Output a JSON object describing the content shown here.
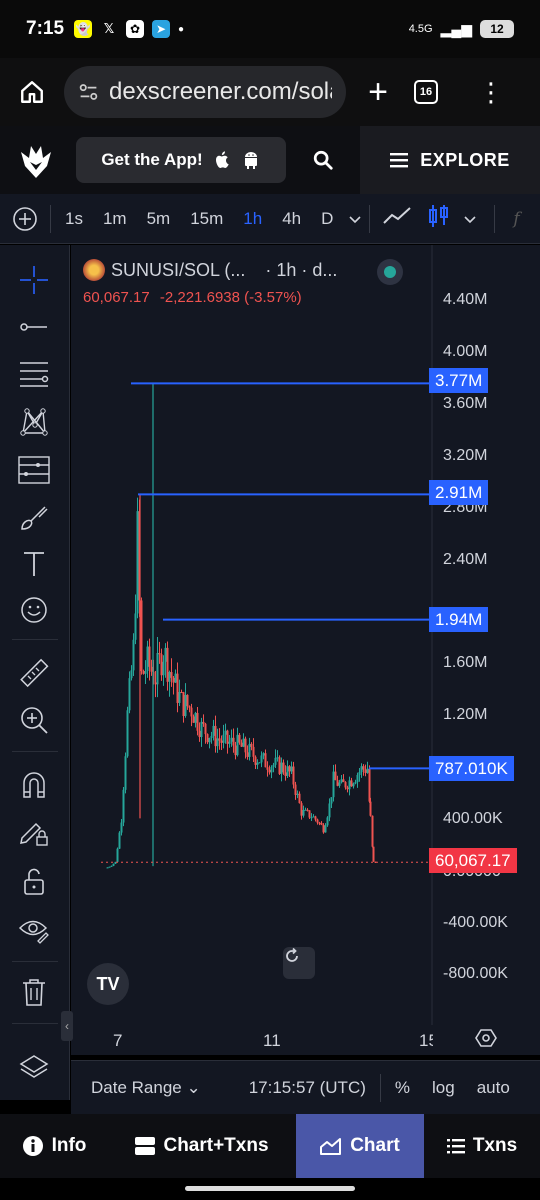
{
  "status": {
    "time": "7:15",
    "network": "4.5G",
    "battery": "12"
  },
  "browser": {
    "url": "dexscreener.com/sola",
    "tab_count": "16"
  },
  "header": {
    "get_app_label": "Get the App!",
    "explore_label": "EXPLORE"
  },
  "timeframes": {
    "items": [
      "1s",
      "1m",
      "5m",
      "15m",
      "1h",
      "4h",
      "D"
    ],
    "active": "1h",
    "fx": "f"
  },
  "chart": {
    "pair": "SUNUSI/SOL (...",
    "interval": "· 1h · d...",
    "last": "60,067.17",
    "change": "-2,221.6938 (-3.57%)",
    "price_scale": [
      "4.40M",
      "4.00M",
      "3.60M",
      "3.20M",
      "2.80M",
      "2.40M",
      "1.60M",
      "1.20M",
      "400.00K",
      "0.00000",
      "-400.00K",
      "-800.00K"
    ],
    "line_tags": [
      "3.77M",
      "2.91M",
      "1.94M",
      "787.010K"
    ],
    "last_price_tag": "60,067.17",
    "x_labels": [
      "7",
      "11",
      "15"
    ],
    "logo_text": "TV"
  },
  "rangebar": {
    "date_range": "Date Range",
    "time_utc": "17:15:57 (UTC)",
    "percent": "%",
    "log": "log",
    "auto": "auto"
  },
  "nav": {
    "info": "Info",
    "chart_txns": "Chart+Txns",
    "chart": "Chart",
    "txns": "Txns"
  },
  "colors": {
    "accent": "#2962ff",
    "up": "#26a69a",
    "down": "#ef5350",
    "nav_active": "#4a57a8"
  },
  "chart_data": {
    "type": "candlestick",
    "title": "SUNUSI/SOL",
    "ylim": [
      -1000000,
      4600000
    ],
    "horizontal_lines": [
      3770000,
      2910000,
      1940000,
      787010
    ],
    "last_price": 60067.17,
    "x_ticks": [
      "7",
      "11",
      "15"
    ]
  }
}
